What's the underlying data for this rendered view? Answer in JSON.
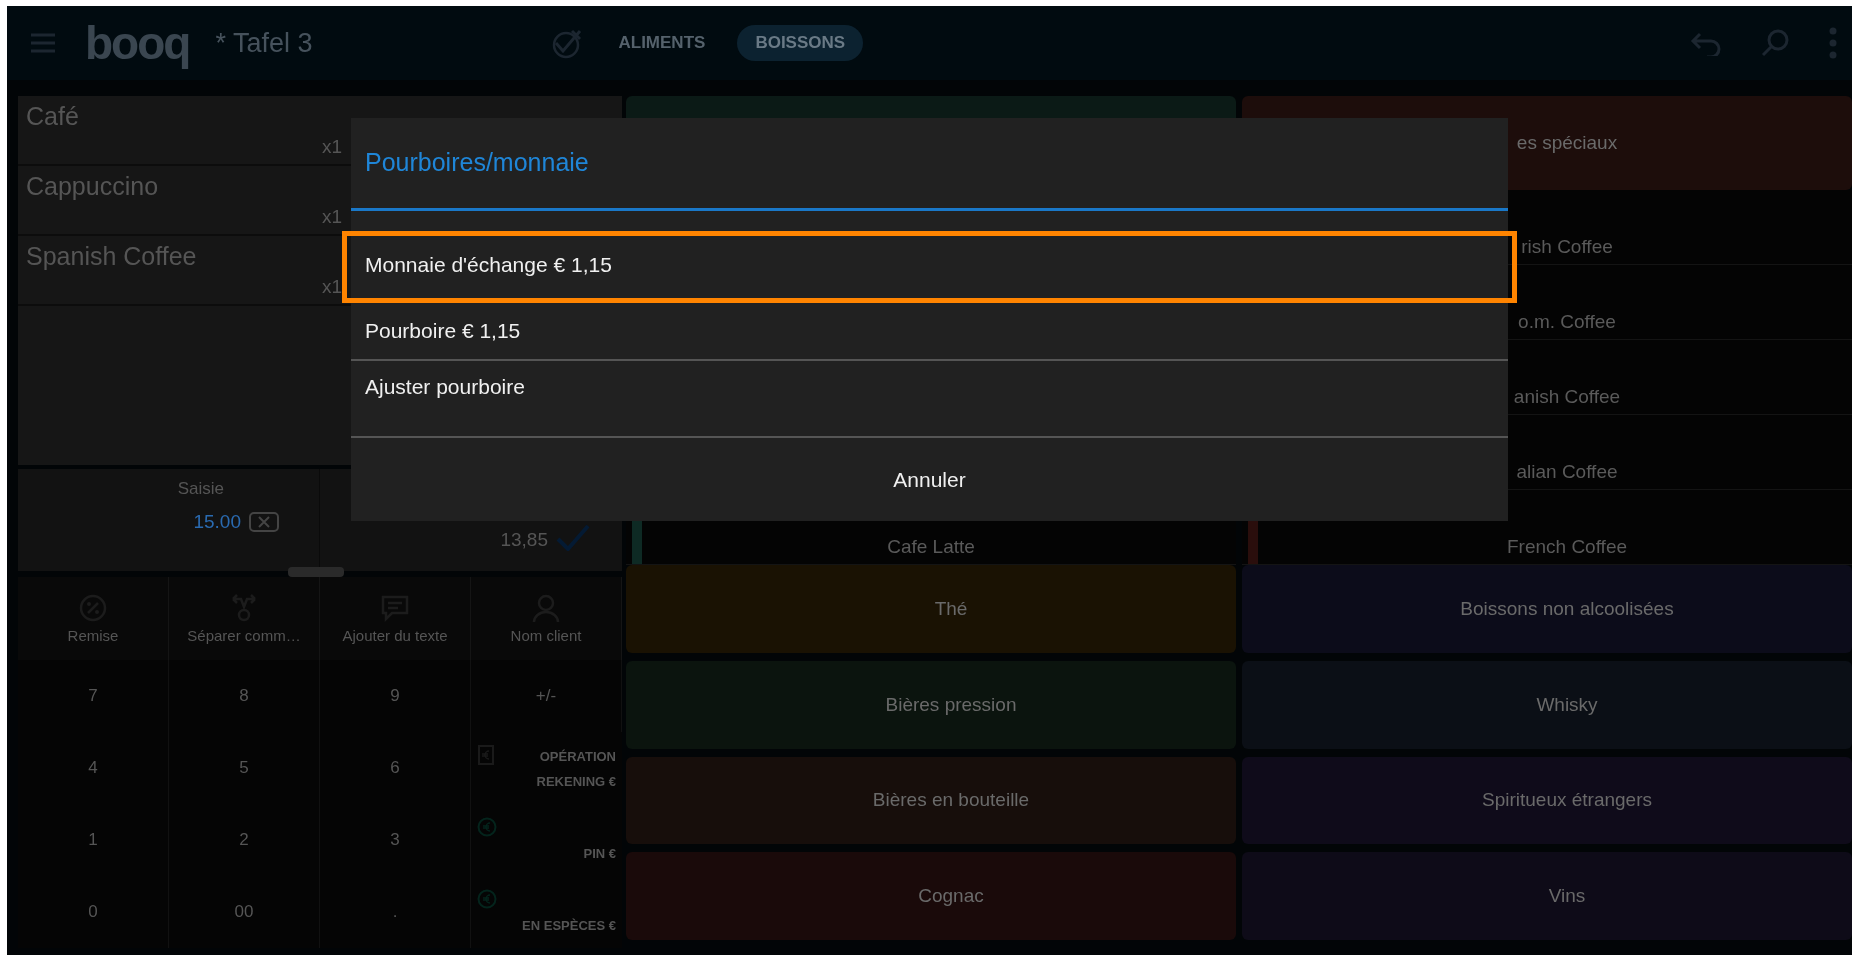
{
  "top_bar": {
    "logo": "booq",
    "table_title": "* Tafel 3",
    "tabs": [
      {
        "label": "ALIMENTS",
        "selected": false
      },
      {
        "label": "BOISSONS",
        "selected": true
      }
    ]
  },
  "order": {
    "items": [
      {
        "name": "Café",
        "quantity": "x1"
      },
      {
        "name": "Cappuccino",
        "quantity": "x1"
      },
      {
        "name": "Spanish Coffee",
        "quantity": "x1"
      }
    ],
    "entry_label": "Saisie",
    "entry_value": "15.00",
    "total": "13,85"
  },
  "actions": [
    {
      "label": "Remise",
      "kind": "discount"
    },
    {
      "label": "Séparer comm…",
      "kind": "split"
    },
    {
      "label": "Ajouter du texte",
      "kind": "text"
    },
    {
      "label": "Nom client",
      "kind": "customer"
    }
  ],
  "keypad": {
    "rows": [
      [
        "7",
        "8",
        "9",
        "+/-"
      ],
      [
        "4",
        "5",
        "6"
      ],
      [
        "1",
        "2",
        "3"
      ],
      [
        "0",
        "00",
        "."
      ]
    ],
    "payments": [
      {
        "label": "OPÉRATION REKENING €",
        "kind": "account"
      },
      {
        "label": "PIN €",
        "kind": "card"
      },
      {
        "label": "EN ESPÈCES €",
        "kind": "cash"
      }
    ]
  },
  "products": {
    "top_tiles": [
      {
        "color": "#0b1a16"
      },
      {
        "label": "es spéciaux",
        "color": "#1d0d0b"
      }
    ],
    "left_items": [
      {
        "label": "Cafe Latte"
      }
    ],
    "right_items": [
      {
        "label": "rish Coffee"
      },
      {
        "label": "o.m. Coffee"
      },
      {
        "label": "anish Coffee"
      },
      {
        "label": "alian Coffee"
      },
      {
        "label": "French Coffee"
      }
    ],
    "categories": [
      {
        "label": "Thé",
        "color": "#1a1203"
      },
      {
        "label": "Boissons non alcoolisées",
        "color": "#0c0c1a"
      },
      {
        "label": "Bières pression",
        "color": "#0b140e"
      },
      {
        "label": "Whisky",
        "color": "#0b0f16"
      },
      {
        "label": "Bières en bouteille",
        "color": "#170e0b"
      },
      {
        "label": "Spiritueux étrangers",
        "color": "#0f0b1a"
      },
      {
        "label": "Cognac",
        "color": "#1a0a0a"
      },
      {
        "label": "Vins",
        "color": "#0e0b18"
      }
    ]
  },
  "dialog": {
    "title": "Pourboires/monnaie",
    "options": [
      {
        "label": "Monnaie d'échange € 1,15",
        "highlighted": true
      },
      {
        "label": "Pourboire € 1,15",
        "highlighted": false
      },
      {
        "label": "Ajuster pourboire",
        "highlighted": false
      }
    ],
    "cancel": "Annuler"
  }
}
